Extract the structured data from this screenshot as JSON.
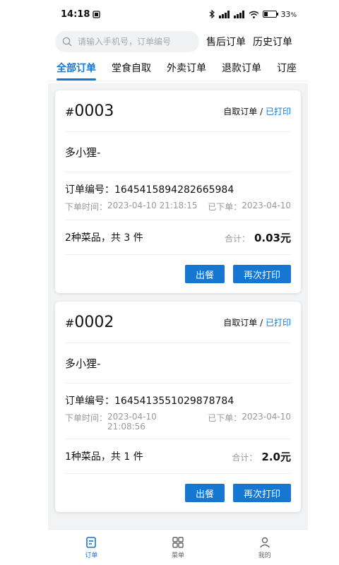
{
  "statusbar": {
    "time": "14:18",
    "battery": "33",
    "battery_unit": "%",
    "network": "5G HD"
  },
  "search": {
    "placeholder": "请输入手机号，订单编号"
  },
  "top_links": {
    "after_sales": "售后订单",
    "history": "历史订单"
  },
  "tabs": [
    "全部订单",
    "堂食自取",
    "外卖订单",
    "退款订单",
    "订座"
  ],
  "orders": [
    {
      "hash": "#",
      "number": "0003",
      "type": "自取订单 /",
      "print_status": "已打印",
      "customer": "多小狸-",
      "order_id": "订单编号：1645415894282665984",
      "order_time_label": "下单时间：",
      "order_time": "2023-04-10 21:18:15",
      "placed_label": "已下单：",
      "placed_date": "2023-04-10",
      "items_summary": "2种菜品，共 3 件",
      "total_label": "合计：",
      "total": "0.03元",
      "btn_serve": "出餐",
      "btn_reprint": "再次打印"
    },
    {
      "hash": "#",
      "number": "0002",
      "type": "自取订单 /",
      "print_status": "已打印",
      "customer": "多小狸-",
      "order_id": "订单编号：1645413551029878784",
      "order_time_label": "下单时间：",
      "order_time": "2023-04-10 21:08:56",
      "placed_label": "已下单：",
      "placed_date": "2023-04-10",
      "items_summary": "1种菜品，共 1 件",
      "total_label": "合计：",
      "total": "2.0元",
      "btn_serve": "出餐",
      "btn_reprint": "再次打印"
    }
  ],
  "bottom_nav": [
    {
      "label": "订单",
      "icon": "order-icon",
      "active": true
    },
    {
      "label": "菜单",
      "icon": "grid-icon",
      "active": false
    },
    {
      "label": "我的",
      "icon": "user-icon",
      "active": false
    }
  ],
  "colors": {
    "accent": "#1677d2",
    "muted": "#999999",
    "background": "#f2f3f5"
  }
}
